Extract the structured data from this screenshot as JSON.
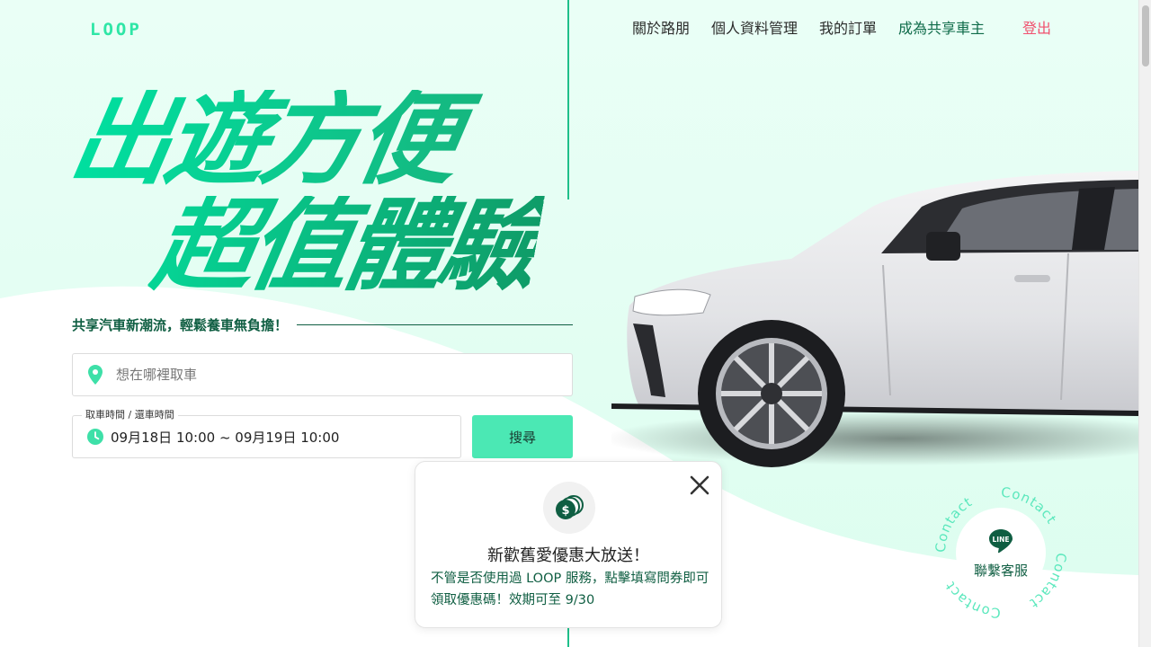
{
  "header": {
    "logo": "LOOP",
    "nav": [
      "關於路朋",
      "個人資料管理",
      "我的訂單",
      "成為共享車主"
    ],
    "logout": "登出"
  },
  "hero": {
    "line1": "出遊方便",
    "line2": "超值體驗",
    "tagline": "共享汽車新潮流，輕鬆養車無負擔！"
  },
  "search": {
    "location_placeholder": "想在哪裡取車",
    "location_value": "",
    "time_legend": "取車時間 / 還車時間",
    "time_value": "09月18日 10:00 ~ 09月19日 10:00",
    "button": "搜尋"
  },
  "popup": {
    "title": "新歡舊愛優惠大放送！",
    "body": "不管是否使用過 LOOP 服務，點擊填寫問券即可領取優惠碼！效期可至 9/30"
  },
  "contact": {
    "line_badge": "LINE",
    "label": "聯繫客服",
    "ring_text": "Contact"
  },
  "colors": {
    "brand": "#2ee6a6",
    "dark_green": "#0f5e42",
    "button": "#4be8b4",
    "logout": "#f0506e"
  }
}
